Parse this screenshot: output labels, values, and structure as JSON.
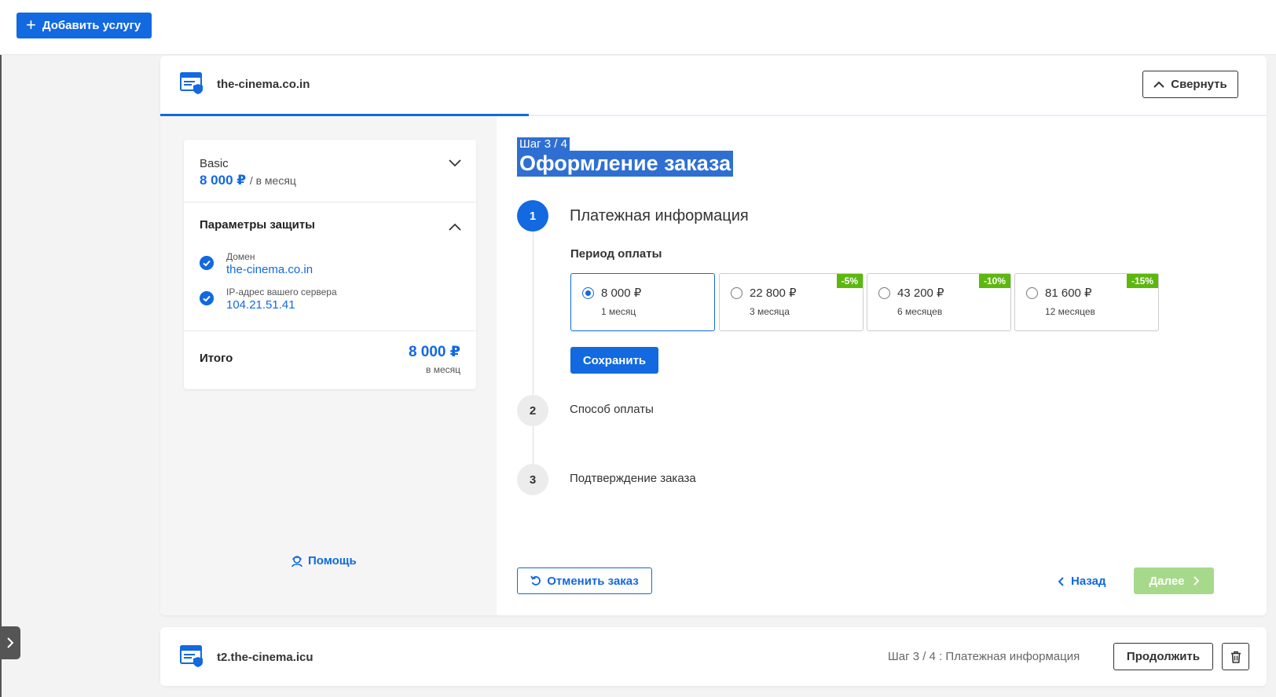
{
  "toolbar": {
    "add_service_label": "Добавить услугу"
  },
  "order_card": {
    "domain": "the-cinema.co.in",
    "collapse_label": "Свернуть",
    "summary": {
      "plan_name": "Basic",
      "plan_price": "8 000 ₽",
      "plan_per": "/ в месяц",
      "params_title": "Параметры защиты",
      "params": [
        {
          "label": "Домен",
          "value": "the-cinema.co.in"
        },
        {
          "label": "IP-адрес вашего сервера",
          "value": "104.21.51.41"
        }
      ],
      "total_label": "Итого",
      "total_price": "8 000 ₽",
      "total_per": "в месяц"
    },
    "help_label": "Помощь",
    "step_counter": "Шаг 3 / 4",
    "title": "Оформление заказа",
    "steps": [
      {
        "number": "1",
        "title": "Платежная информация"
      },
      {
        "number": "2",
        "title": "Способ оплаты"
      },
      {
        "number": "3",
        "title": "Подтверждение заказа"
      }
    ],
    "period_label": "Период оплаты",
    "periods": [
      {
        "price": "8 000 ₽",
        "period": "1 месяц",
        "discount": "",
        "selected": true
      },
      {
        "price": "22 800 ₽",
        "period": "3 месяца",
        "discount": "-5%",
        "selected": false
      },
      {
        "price": "43 200 ₽",
        "period": "6 месяцев",
        "discount": "-10%",
        "selected": false
      },
      {
        "price": "81 600 ₽",
        "period": "12 месяцев",
        "discount": "-15%",
        "selected": false
      }
    ],
    "save_label": "Сохранить",
    "cancel_label": "Отменить заказ",
    "back_label": "Назад",
    "next_label": "Далее"
  },
  "second_card": {
    "domain": "t2.the-cinema.icu",
    "status": "Шаг 3 / 4 : Платежная информация",
    "continue_label": "Продолжить"
  },
  "colors": {
    "primary": "#1269e0",
    "discount": "#5cb80e",
    "next_disabled": "#a7d98a",
    "selection": "#2f6fd1"
  },
  "icons": [
    "plus-icon",
    "service-shield-icon",
    "chevron-up-icon",
    "chevron-down-icon",
    "check-icon",
    "support-agent-icon",
    "undo-icon",
    "chevron-left-icon",
    "chevron-right-icon",
    "trash-icon"
  ]
}
